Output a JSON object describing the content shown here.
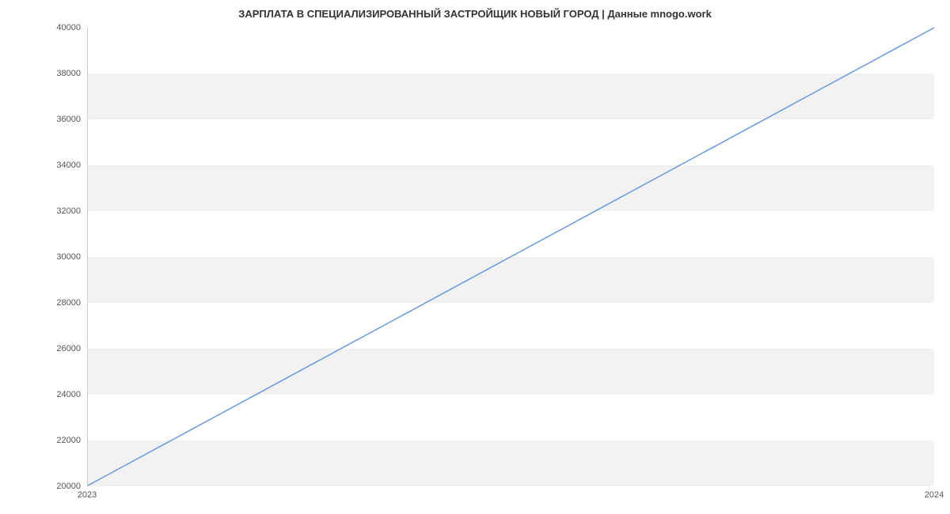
{
  "chart_data": {
    "type": "line",
    "title": "ЗАРПЛАТА В СПЕЦИАЛИЗИРОВАННЫЙ ЗАСТРОЙЩИК НОВЫЙ ГОРОД | Данные mnogo.work",
    "xlabel": "",
    "ylabel": "",
    "x": [
      2023,
      2024
    ],
    "values": [
      20000,
      40000
    ],
    "xticks": [
      2023,
      2024
    ],
    "yticks": [
      20000,
      22000,
      24000,
      26000,
      28000,
      30000,
      32000,
      34000,
      36000,
      38000,
      40000
    ],
    "ylim": [
      20000,
      40000
    ],
    "xlim": [
      2023,
      2024
    ],
    "line_color": "#6699e0"
  }
}
